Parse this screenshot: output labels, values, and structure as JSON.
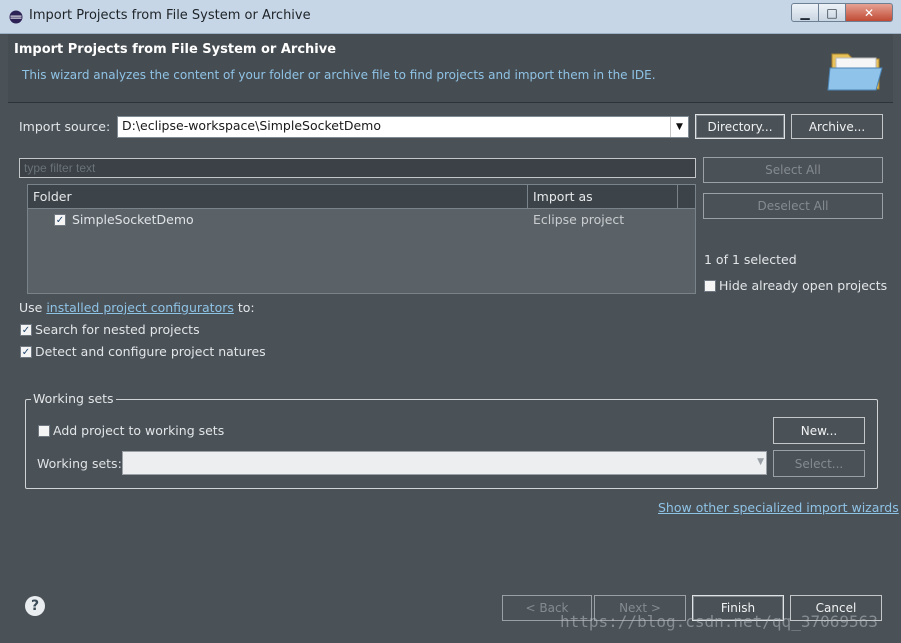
{
  "window": {
    "title": "Import Projects from File System or Archive",
    "controls": {
      "minimize": "▁",
      "maximize": "□",
      "close": "✕"
    }
  },
  "header": {
    "title": "Import Projects from File System or Archive",
    "description": "This wizard analyzes the content of your folder or archive file to find projects and import them in the IDE.",
    "icon": "open-folder-icon"
  },
  "import_source": {
    "label": "Import source:",
    "value": "D:\\eclipse-workspace\\SimpleSocketDemo",
    "directory_button": "Directory...",
    "archive_button": "Archive..."
  },
  "filter": {
    "placeholder": "type filter text"
  },
  "table": {
    "columns": [
      "Folder",
      "Import as"
    ],
    "rows": [
      {
        "folder": "SimpleSocketDemo",
        "import_as": "Eclipse project",
        "checked": true
      }
    ]
  },
  "selection": {
    "select_all": "Select All",
    "deselect_all": "Deselect All",
    "count": "1 of 1 selected",
    "hide_open_label": "Hide already open projects",
    "hide_open_checked": false
  },
  "options": {
    "use_prefix": "Use ",
    "configurators_link": "installed project configurators",
    "use_suffix": " to:",
    "nested_label": "Search for nested projects",
    "nested_checked": true,
    "natures_label": "Detect and configure project natures",
    "natures_checked": true
  },
  "working_sets": {
    "group_label": "Working sets",
    "add_label": "Add project to working sets",
    "add_checked": false,
    "new_button": "New...",
    "sets_label": "Working sets:",
    "sets_value": "",
    "select_button": "Select..."
  },
  "other_wizards_link": "Show other specialized import wizards",
  "footer": {
    "back": "< Back",
    "next": "Next >",
    "finish": "Finish",
    "cancel": "Cancel"
  },
  "watermark": "https://blog.csdn.net/qq_37069563",
  "colors": {
    "background": "#4a5157",
    "link": "#8fc3e6",
    "titlebar": "#c7d6e6"
  }
}
